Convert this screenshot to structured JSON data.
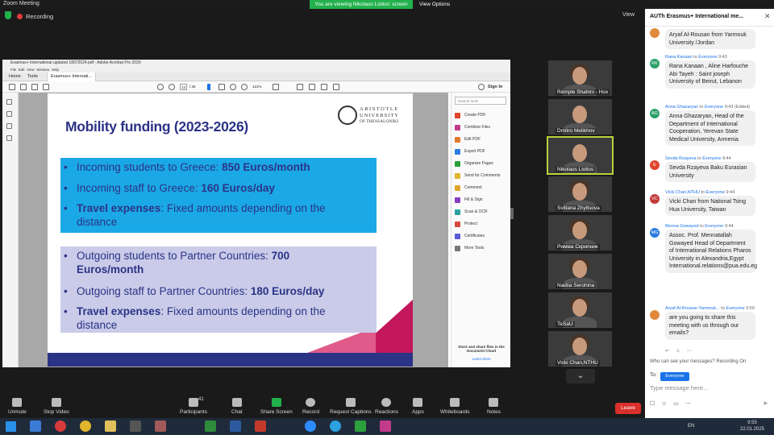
{
  "zoom": {
    "window_title": "Zoom Meeting",
    "banner": "You are viewing Nikolaos Liolios' screen",
    "view_options": "View Options",
    "recording": "Recording",
    "view": "View"
  },
  "acrobat": {
    "title": "Erasmus+ International updated 18072024.pdf - Adobe Acrobat Pro 2020",
    "menu": [
      "File",
      "Edit",
      "View",
      "Window",
      "Help"
    ],
    "tabs": [
      "Home",
      "Tools",
      "Erasmus+ Internati..."
    ],
    "page_current": "12",
    "page_total": "/ 25",
    "zoom": "121%",
    "sign_in": "Sign In",
    "search_tools_placeholder": "Search tools",
    "tools": [
      "Create PDF",
      "Combine Files",
      "Edit PDF",
      "Export PDF",
      "Organize Pages",
      "Send for Comments",
      "Comment",
      "Fill & Sign",
      "Scan & OCR",
      "Protect",
      "Certificates",
      "More Tools"
    ],
    "tool_colors": [
      "#e0452c",
      "#c23a8a",
      "#e07a2c",
      "#2c7de0",
      "#2ca03c",
      "#e0b52c",
      "#e0a52c",
      "#8a3cc2",
      "#2ca0a0",
      "#d64a3c",
      "#5a5ad6",
      "#777777"
    ],
    "cloud_text": "Store and share files in the Document Cloud",
    "learn_more": "Learn More"
  },
  "slide": {
    "title": "Mobility funding (2023-2026)",
    "logo_line1": "ARISTOTLE",
    "logo_line2": "UNIVERSITY",
    "logo_line3": "OF THESSALONIKI",
    "incoming": [
      {
        "text": "Incoming students to Greece: ",
        "bold": "850 Euros/month"
      },
      {
        "text": "Incoming staff to Greece: ",
        "bold": "160 Euros/day"
      },
      {
        "bold_lead": "Travel expenses",
        "text": ": Fixed amounts depending on the distance"
      }
    ],
    "outgoing": [
      {
        "text": "Outgoing students to Partner Countries: ",
        "bold": "700 Euros/month"
      },
      {
        "text": "Outgoing staff to Partner Countries: ",
        "bold": "180 Euros/day"
      },
      {
        "bold_lead": "Travel expenses",
        "text": ": Fixed amounts depending on the distance"
      }
    ]
  },
  "participants": [
    {
      "name": "Rémple Shahini - Hox"
    },
    {
      "name": "Dmitro Melikhov"
    },
    {
      "name": "Nikolaos Liolios"
    },
    {
      "name": "Svitlana Zhyltsova"
    },
    {
      "name": "Римма Скрипник"
    },
    {
      "name": "Nadiia Serohina"
    },
    {
      "name": "TeSaU"
    },
    {
      "name": "Vicki Chan,NTHU"
    }
  ],
  "toolbar": {
    "unmute": "Unmute",
    "stop_video": "Stop Video",
    "participants": "Participants",
    "participants_count": "41",
    "chat": "Chat",
    "share_screen": "Share Screen",
    "record": "Record",
    "request_captions": "Request Captions",
    "reactions": "Reactions",
    "apps": "Apps",
    "whiteboards": "Whiteboards",
    "notes": "Notes",
    "leave": "Leave"
  },
  "chat": {
    "title": "AUTh Erasmus+ International me...",
    "messages": [
      {
        "sender": "",
        "to": "",
        "time": "",
        "edited": "",
        "text": "Aryaf Al-Rousan from Yarmouk University /Jordan",
        "initials": "",
        "color": "#e08a3c"
      },
      {
        "sender": "Rana Kanaan",
        "to": "Everyone",
        "time": "9:43",
        "edited": "",
        "text": "Rana Kanaan , Aline Harfouche Abi Tayeh : Saint joseph University of Beirut, Lebanon",
        "initials": "RK",
        "color": "#2ca06a"
      },
      {
        "sender": "Anna Ghazaryan",
        "to": "Everyone",
        "time": "9:43",
        "edited": "(Edited)",
        "text": "Anna Ghazaryan, Head of the Department of International Cooperation, Yerevan State Medical University, Armenia",
        "initials": "AG",
        "color": "#2ca06a"
      },
      {
        "sender": "Sevda Rzayeva",
        "to": "Everyone",
        "time": "9:44",
        "edited": "",
        "text": "Sevda Rzayeva Baku Eurasian University",
        "initials": "E",
        "color": "#e0452c"
      },
      {
        "sender": "Vicki Chan,NTHU",
        "to": "Everyone",
        "time": "9:44",
        "edited": "",
        "text": "Vicki Chan from National Tsing Hua University, Taiwan",
        "initials": "VC",
        "color": "#c23a3a"
      },
      {
        "sender": "Menna Gowayed",
        "to": "Everyone",
        "time": "9:44",
        "edited": "",
        "text": "Assoc. Prof. Mennatallah Gowayed Head of Department of International Relations Pharos University in Alexandria,Egypt International.relations@pua.edu.eg",
        "initials": "MG",
        "color": "#2c7de0"
      },
      {
        "sender": "Aryaf Al-Rousan-Yarmouk...",
        "to": "Everyone",
        "time": "9:50",
        "edited": "",
        "text": "are you going to share this meeting with us through our emails?",
        "initials": "",
        "color": "#e08a3c"
      }
    ],
    "who_can_see": "Who can see your messages? Recording On",
    "to_label": "To:",
    "to_value": "Everyone",
    "input_placeholder": "Type message here..."
  },
  "taskbar": {
    "lang": "EN",
    "time": "9:55",
    "date": "22.01.2025"
  }
}
